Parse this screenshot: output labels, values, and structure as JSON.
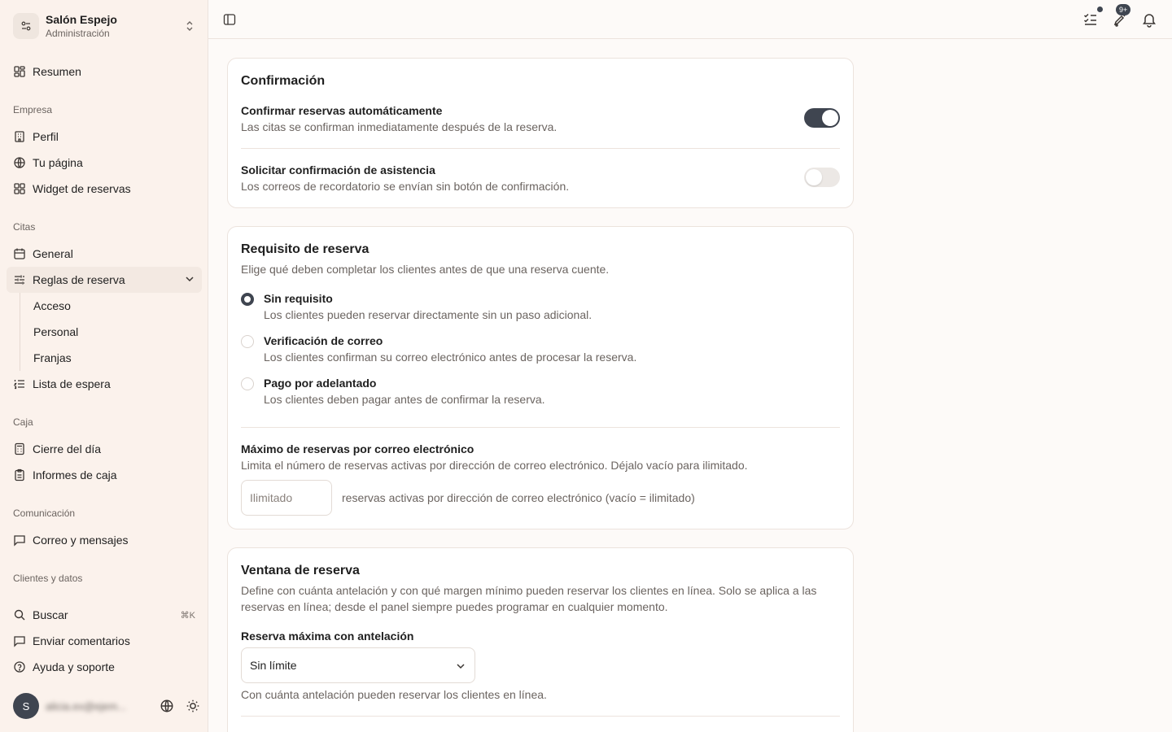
{
  "org": {
    "name": "Salón Espejo",
    "role": "Administración"
  },
  "nav": {
    "resumen": "Resumen",
    "section_empresa": "Empresa",
    "perfil": "Perfil",
    "tu_pagina": "Tu página",
    "widget": "Widget de reservas",
    "section_citas": "Citas",
    "general": "General",
    "reglas": "Reglas de reserva",
    "sub": [
      "Acceso",
      "Personal",
      "Franjas"
    ],
    "lista_espera": "Lista de espera",
    "section_caja": "Caja",
    "cierre": "Cierre del día",
    "informes": "Informes de caja",
    "section_comunicacion": "Comunicación",
    "correo": "Correo y mensajes",
    "section_clientes": "Clientes y datos",
    "buscar": "Buscar",
    "buscar_shortcut": "⌘K",
    "comentarios": "Enviar comentarios",
    "ayuda": "Ayuda y soporte"
  },
  "user": {
    "initial": "S",
    "email": "alicia.ex@ejem..."
  },
  "topbar": {
    "badge": "9+"
  },
  "confirmacion": {
    "title": "Confirmación",
    "auto_title": "Confirmar reservas automáticamente",
    "auto_desc": "Las citas se confirman inmediatamente después de la reserva.",
    "auto_on": true,
    "asistencia_title": "Solicitar confirmación de asistencia",
    "asistencia_desc": "Los correos de recordatorio se envían sin botón de confirmación.",
    "asistencia_on": false
  },
  "requisito": {
    "title": "Requisito de reserva",
    "desc": "Elige qué deben completar los clientes antes de que una reserva cuente.",
    "options": [
      {
        "title": "Sin requisito",
        "desc": "Los clientes pueden reservar directamente sin un paso adicional.",
        "checked": true
      },
      {
        "title": "Verificación de correo",
        "desc": "Los clientes confirman su correo electrónico antes de procesar la reserva.",
        "checked": false
      },
      {
        "title": "Pago por adelantado",
        "desc": "Los clientes deben pagar antes de confirmar la reserva.",
        "checked": false
      }
    ],
    "max_title": "Máximo de reservas por correo electrónico",
    "max_desc": "Limita el número de reservas activas por dirección de correo electrónico. Déjalo vacío para ilimitado.",
    "max_placeholder": "Ilimitado",
    "max_suffix": "reservas activas por dirección de correo electrónico (vacío = ilimitado)"
  },
  "ventana": {
    "title": "Ventana de reserva",
    "desc": "Define con cuánta antelación y con qué margen mínimo pueden reservar los clientes en línea. Solo se aplica a las reservas en línea; desde el panel siempre puedes programar en cualquier momento.",
    "max_label": "Reserva máxima con antelación",
    "max_value": "Sin límite",
    "max_help": "Con cuánta antelación pueden reservar los clientes en línea."
  }
}
